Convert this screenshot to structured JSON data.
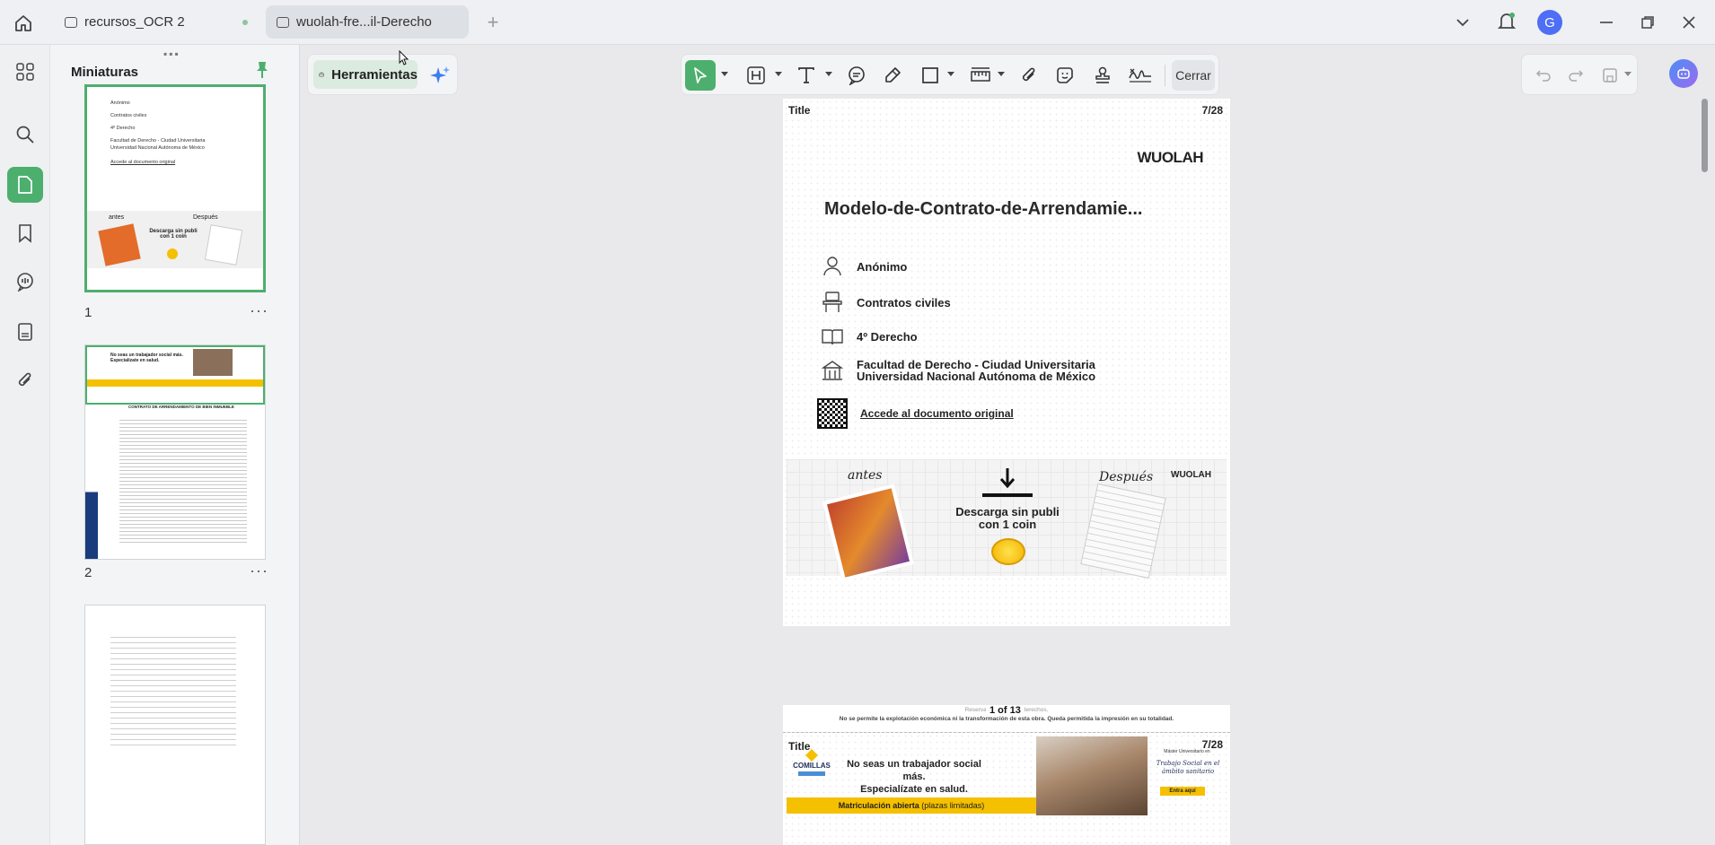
{
  "tabs": [
    {
      "label": "recursos_OCR 2"
    },
    {
      "label": "wuolah-fre...il-Derecho"
    }
  ],
  "account": {
    "avatar_letter": "G"
  },
  "sidebar": {
    "title": "Miniaturas",
    "thumbnails": [
      {
        "number": "1"
      },
      {
        "number": "2"
      }
    ],
    "thumb1": {
      "rows": [
        "Anónimo",
        "Contratos civiles",
        "4º Derecho",
        "Facultad de Derecho - Ciudad Universitaria",
        "Universidad Nacional Autónoma de México"
      ],
      "link": "Accede al documento original",
      "ad_before": "antes",
      "ad_after": "Después",
      "ad_cta": "Descarga sin publi con 1 coin"
    },
    "thumb2": {
      "ad_text": "No seas un trabajador social más. Especialízate en salud.",
      "heading": "CONTRATO DE ARRENDAMIENTO DE BIEN INMUEBLE"
    }
  },
  "toolbar": {
    "tools_label": "Herramientas",
    "close_label": "Cerrar"
  },
  "page": {
    "header_left": "Title",
    "header_right": "7/28",
    "brand": "WUOLAH",
    "title": "Modelo-de-Contrato-de-Arrendamie...",
    "meta": [
      {
        "icon": "user-icon",
        "text": "Anónimo"
      },
      {
        "icon": "desk-icon",
        "text": "Contratos civiles"
      },
      {
        "icon": "book-icon",
        "text": "4º Derecho"
      },
      {
        "icon": "building-icon",
        "text": "Facultad de Derecho - Ciudad Universitaria",
        "text2": "Universidad Nacional Autónoma de México"
      }
    ],
    "link": "Accede al documento original",
    "ad": {
      "before": "antes",
      "after": "Después",
      "brand": "WUOLAH",
      "cta_line1": "Descarga sin publi",
      "cta_line2": "con 1 coin"
    },
    "footer_line1": "Reservados todos los derechos.",
    "footer_line2": "No se permite la explotación económica ni la transformación de esta obra. Queda permitida la impresión en su totalidad.",
    "page_indicator": "1 of 13"
  },
  "page2": {
    "header_left": "Title",
    "header_right": "7/28",
    "school": "COMILLAS",
    "ad_line1": "No seas un trabajador social más.",
    "ad_line2": "Especialízate en salud.",
    "banner": "Matriculación abierta",
    "banner_extra": "(plazas limitadas)",
    "right_small": "Máster Universitario en",
    "right_title": "Trabajo Social en el ámbito sanitario",
    "cta": "Entra aquí"
  },
  "colors": {
    "accent": "#4caf6e",
    "avatar": "#4d6ef5",
    "ad_yellow": "#f5c000"
  }
}
